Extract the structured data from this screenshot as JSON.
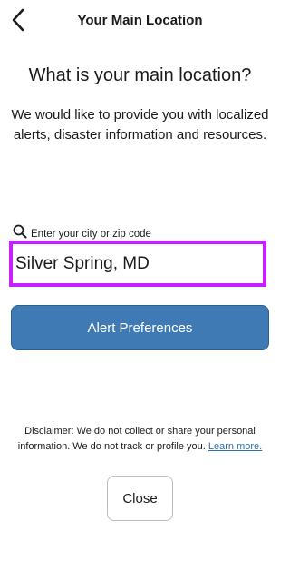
{
  "header": {
    "title": "Your Main Location",
    "back_icon": "chevron-left-icon"
  },
  "main": {
    "question": "What is your main location?",
    "intro": "We would like to provide you with localized alerts, disaster information and resources."
  },
  "search": {
    "icon": "search-icon",
    "label": "Enter your city or zip code",
    "value": "Silver Spring, MD",
    "highlight_color": "#c620ff"
  },
  "alert_button": {
    "label": "Alert Preferences",
    "color": "#3f7ab4"
  },
  "disclaimer": {
    "text": "Disclaimer: We do not collect or share your personal information. We do not track or profile you.",
    "link_label": "Learn more."
  },
  "close_button": {
    "label": "Close"
  }
}
